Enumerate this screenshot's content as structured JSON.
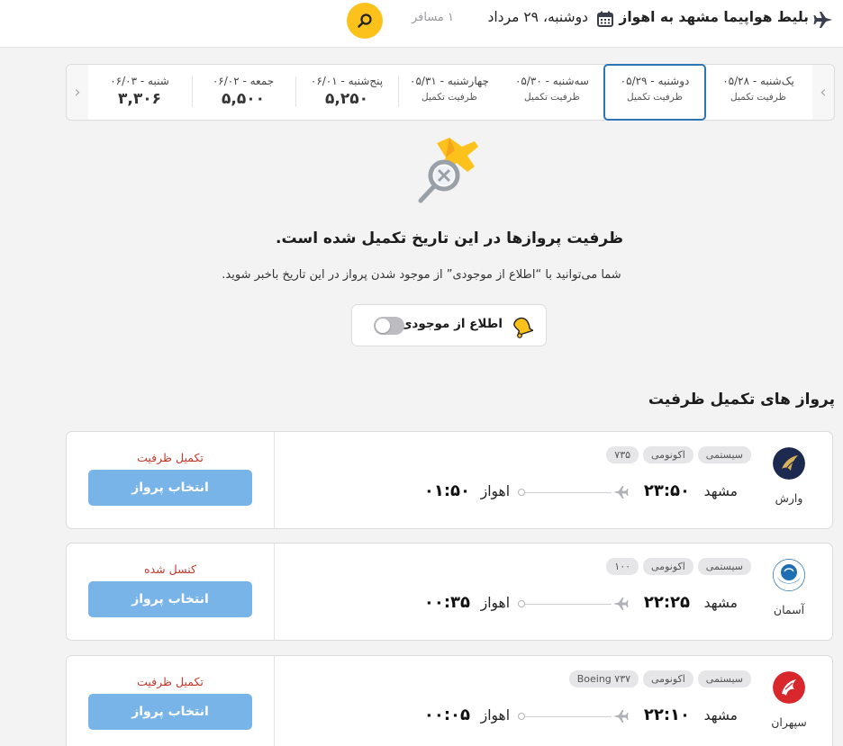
{
  "header": {
    "route_title": "بلیط هواپیما مشهد به اهواز",
    "date_text": "دوشنبه، ۲۹ مرداد",
    "passengers": "۱ مسافر",
    "icons": {
      "plane": "plane-icon",
      "calendar": "calendar-icon",
      "search": "search-icon"
    },
    "accent_color": "#fcc21b"
  },
  "date_strip": {
    "days": [
      {
        "name": "یک‌شنبه - ۰۵/۲۸",
        "sub": "ظرفیت تکمیل",
        "price": ""
      },
      {
        "name": "دوشنبه - ۰۵/۲۹",
        "sub": "ظرفیت تکمیل",
        "price": "",
        "selected": true
      },
      {
        "name": "سه‌شنبه - ۰۵/۳۰",
        "sub": "ظرفیت تکمیل",
        "price": ""
      },
      {
        "name": "چهارشنبه - ۰۵/۳۱",
        "sub": "ظرفیت تکمیل",
        "price": ""
      },
      {
        "name": "پنج‌شنبه - ۰۶/۰۱",
        "sub": "",
        "price": "۵,۲۵۰"
      },
      {
        "name": "جمعه - ۰۶/۰۲",
        "sub": "",
        "price": "۵,۵۰۰"
      },
      {
        "name": "شنبه - ۰۶/۰۳",
        "sub": "",
        "price": "۳,۳۰۶"
      }
    ],
    "selected_color": "#2e75b6"
  },
  "empty_state": {
    "title": "ظرفیت پروازها در این تاریخ تکمیل شده است.",
    "description": "شما می‌توانید با “اطلاع از موجودی” از موجود شدن پرواز در این تاریخ باخبر شوید.",
    "notify_label": "اطلاع از موجودی",
    "notify_enabled": false
  },
  "section_title": "پرواز های تکمیل ظرفیت",
  "flights": [
    {
      "airline": "وارش",
      "tags": [
        "سیستمی",
        "اکونومی",
        "۷۳۵"
      ],
      "origin": "مشهد",
      "departure_time": "۲۳:۵۰",
      "destination": "اهواز",
      "arrival_time": "۰۱:۵۰",
      "status": "تکمیل ظرفیت",
      "button": "انتخاب پرواز",
      "logo_color": "#1c2a4f"
    },
    {
      "airline": "آسمان",
      "tags": [
        "سیستمی",
        "اکونومی",
        "۱۰۰"
      ],
      "origin": "مشهد",
      "departure_time": "۲۲:۲۵",
      "destination": "اهواز",
      "arrival_time": "۰۰:۳۵",
      "status": "کنسل شده",
      "button": "انتخاب پرواز",
      "logo_color": "#1f6fb5"
    },
    {
      "airline": "سپهران",
      "tags": [
        "سیستمی",
        "اکونومی",
        "Boeing ۷۳۷"
      ],
      "origin": "مشهد",
      "departure_time": "۲۲:۱۰",
      "destination": "اهواز",
      "arrival_time": "۰۰:۰۵",
      "status": "تکمیل ظرفیت",
      "button": "انتخاب پرواز",
      "logo_color": "#d9272e"
    }
  ],
  "status_color": "#c0392b",
  "button_color": "#79b4e8"
}
